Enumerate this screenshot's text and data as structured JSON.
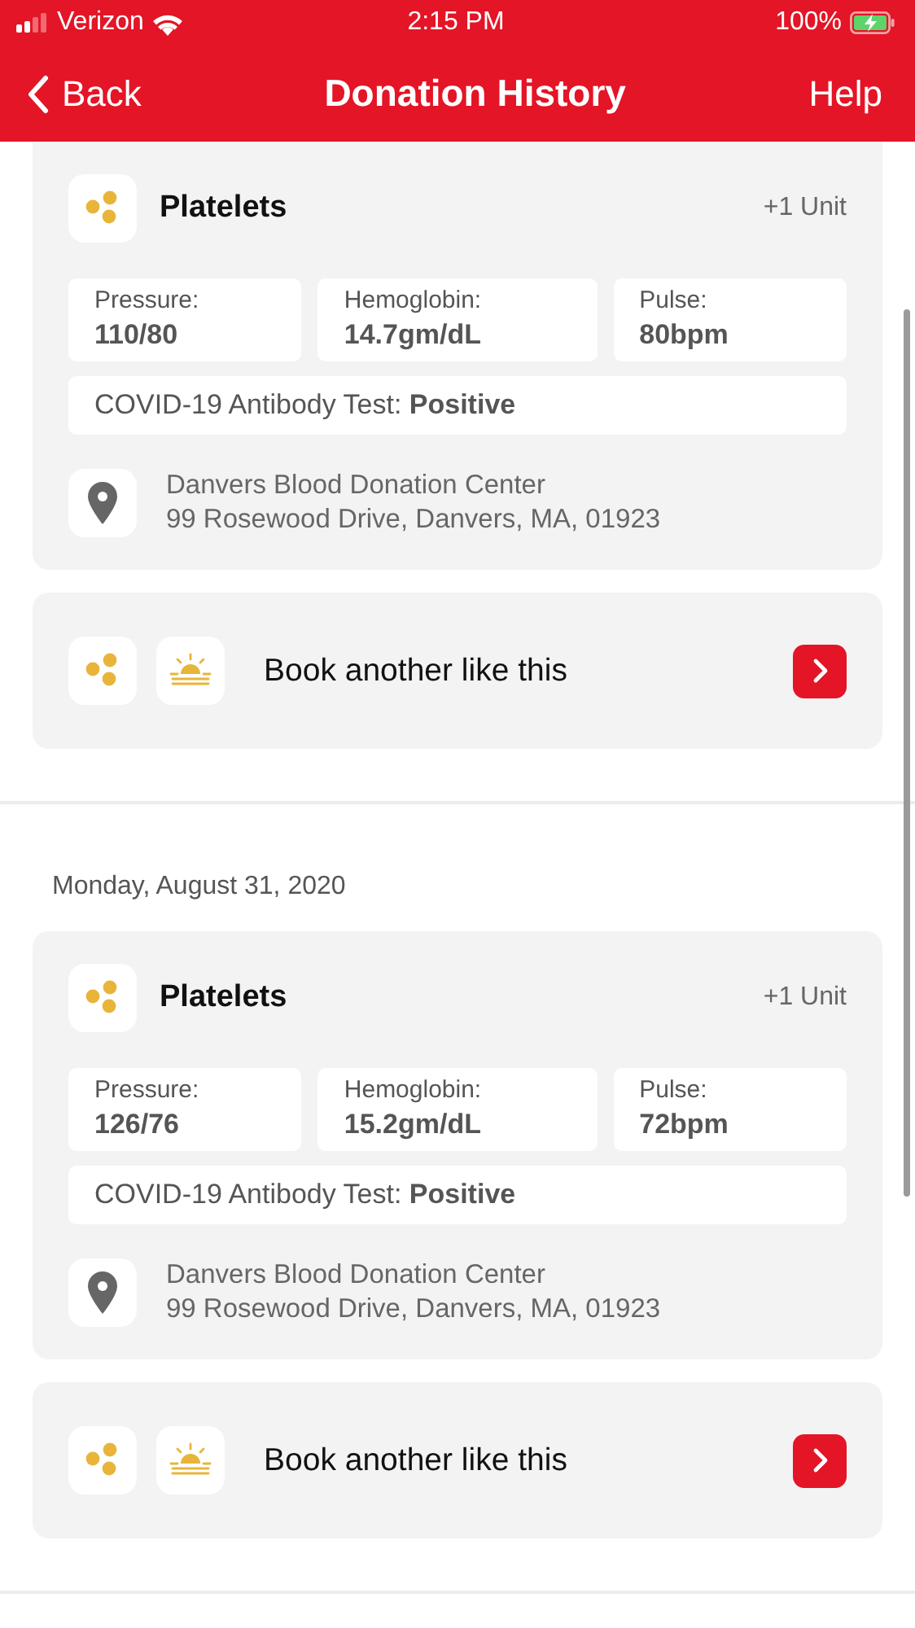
{
  "status_bar": {
    "carrier": "Verizon",
    "time": "2:15 PM",
    "battery": "100%"
  },
  "nav": {
    "back": "Back",
    "title": "Donation History",
    "help": "Help"
  },
  "donations": [
    {
      "type": "Platelets",
      "units": "+1 Unit",
      "metrics": [
        {
          "label": "Pressure:",
          "value": "110/80"
        },
        {
          "label": "Hemoglobin:",
          "value": "14.7gm/dL"
        },
        {
          "label": "Pulse:",
          "value": "80bpm"
        }
      ],
      "test_label": "COVID-19 Antibody Test:",
      "test_result": "Positive",
      "center": "Danvers Blood Donation Center",
      "address": "99 Rosewood Drive, Danvers, MA, 01923",
      "book": "Book another like this"
    },
    {
      "date": "Monday, August 31, 2020",
      "type": "Platelets",
      "units": "+1 Unit",
      "metrics": [
        {
          "label": "Pressure:",
          "value": "126/76"
        },
        {
          "label": "Hemoglobin:",
          "value": "15.2gm/dL"
        },
        {
          "label": "Pulse:",
          "value": "72bpm"
        }
      ],
      "test_label": "COVID-19 Antibody Test:",
      "test_result": "Positive",
      "center": "Danvers Blood Donation Center",
      "address": "99 Rosewood Drive, Danvers, MA, 01923",
      "book": "Book another like this"
    }
  ]
}
